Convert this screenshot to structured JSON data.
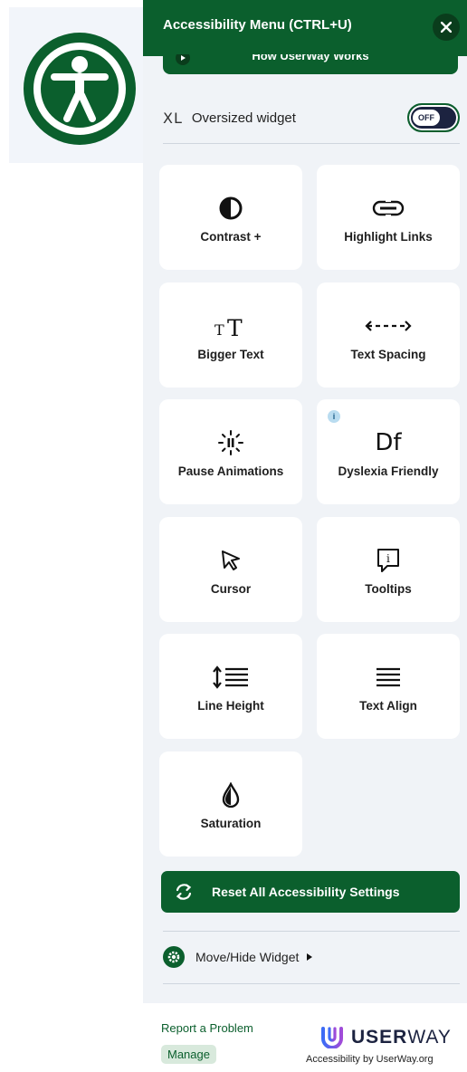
{
  "launcher": {
    "icon": "accessibility-person-icon"
  },
  "panel": {
    "header_title": "Accessibility Menu (CTRL+U)",
    "close_icon": "close-icon",
    "how_button_label": "How UserWay Works",
    "oversized": {
      "tag": "XL",
      "label": "Oversized widget",
      "toggle_state": "OFF"
    },
    "tiles": [
      {
        "label": "Contrast +",
        "icon": "contrast-icon"
      },
      {
        "label": "Highlight Links",
        "icon": "link-icon"
      },
      {
        "label": "Bigger Text",
        "icon": "text-size-icon",
        "glyph": "TT"
      },
      {
        "label": "Text Spacing",
        "icon": "text-spacing-icon",
        "glyph": "←---→"
      },
      {
        "label": "Pause Animations",
        "icon": "pause-animations-icon"
      },
      {
        "label": "Dyslexia Friendly",
        "icon": "dyslexia-icon",
        "glyph": "Df",
        "info": "i"
      },
      {
        "label": "Cursor",
        "icon": "cursor-icon"
      },
      {
        "label": "Tooltips",
        "icon": "tooltip-icon",
        "glyph": "i"
      },
      {
        "label": "Line Height",
        "icon": "line-height-icon"
      },
      {
        "label": "Text Align",
        "icon": "text-align-icon"
      },
      {
        "label": "Saturation",
        "icon": "saturation-icon"
      }
    ],
    "reset_label": "Reset All Accessibility Settings",
    "move_hide_label": "Move/Hide Widget",
    "footer": {
      "report_label": "Report a Problem",
      "manage_label": "Manage",
      "brand_bold": "USER",
      "brand_light": "WAY",
      "brand_sub": "Accessibility by UserWay.org"
    }
  },
  "colors": {
    "brand_green": "#0b5f2d",
    "panel_bg": "#f0f3f7",
    "navy": "#1c2340"
  }
}
